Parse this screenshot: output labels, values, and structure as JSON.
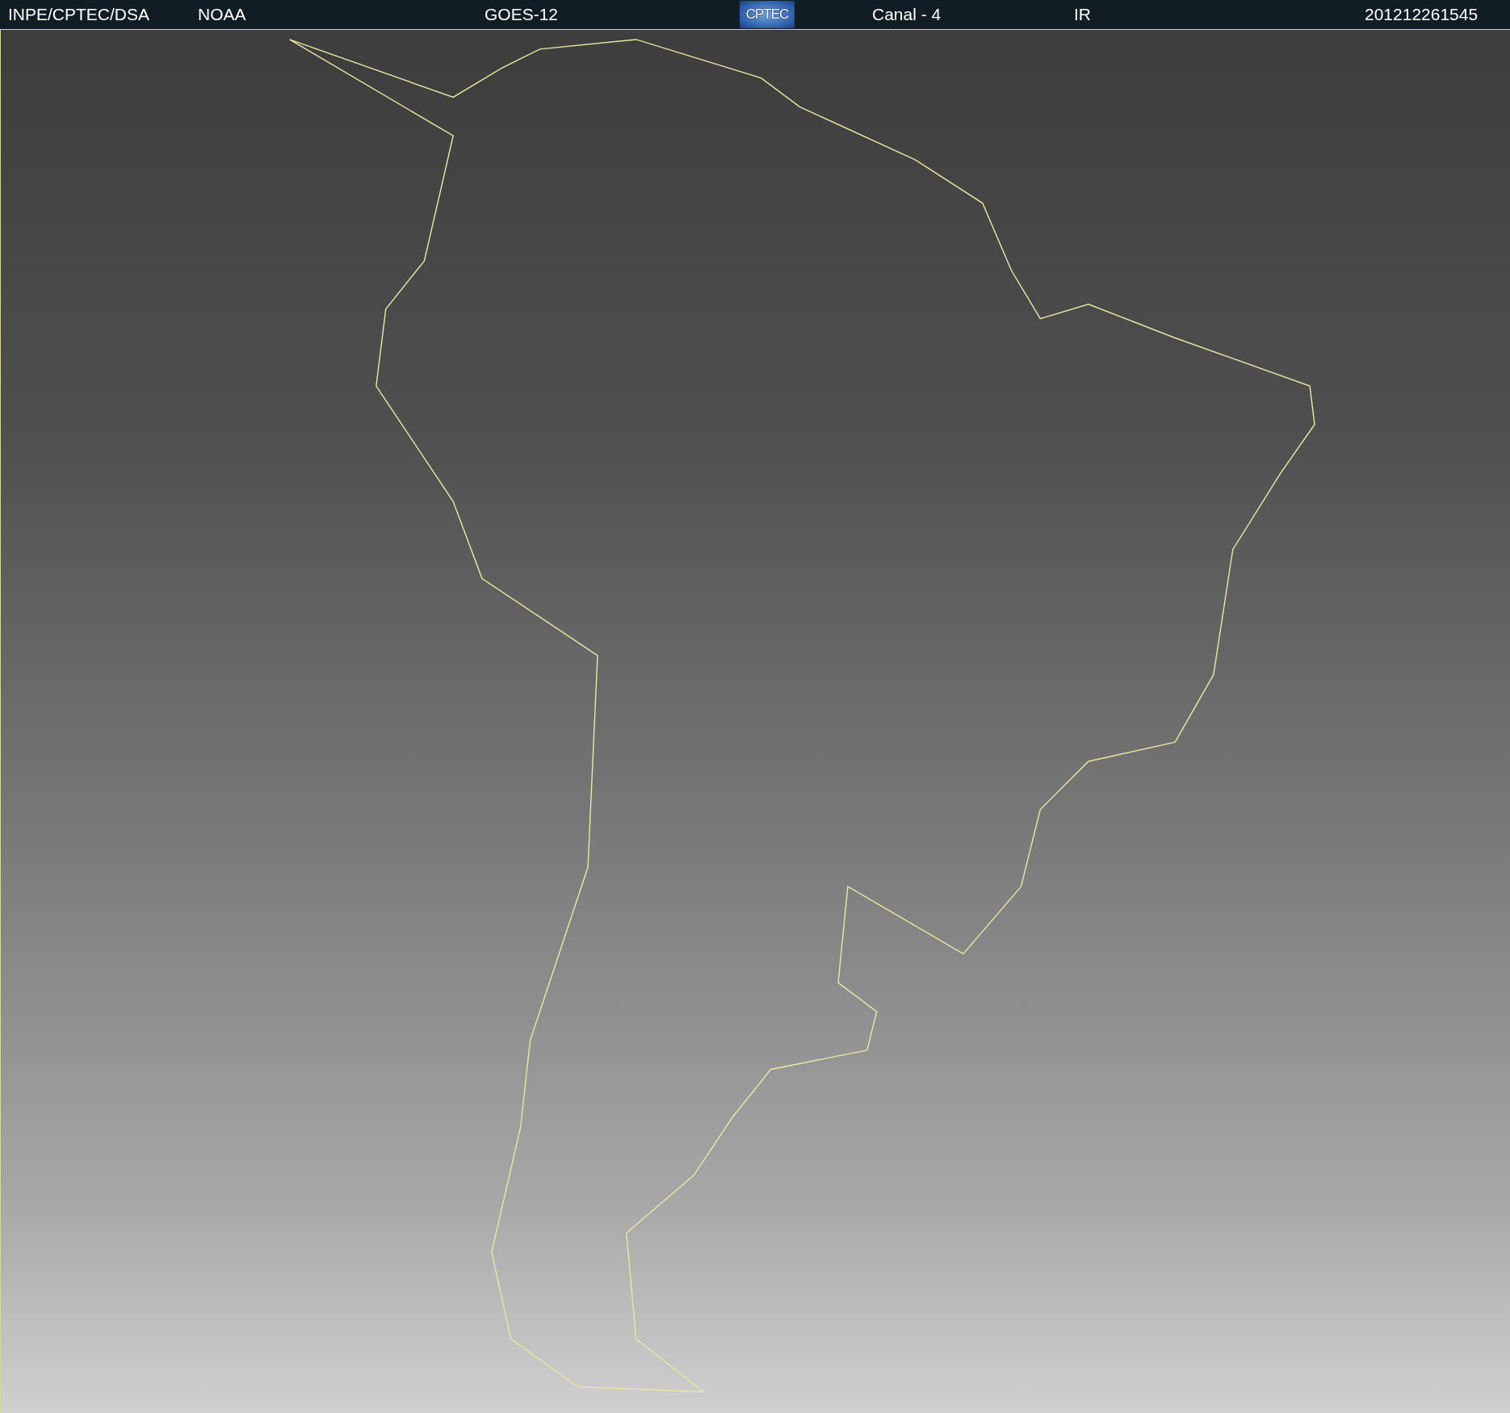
{
  "header": {
    "items": [
      {
        "kind": "text",
        "label": "INPE/CPTEC/DSA"
      },
      {
        "kind": "text",
        "label": "NOAA"
      },
      {
        "kind": "text",
        "label": "GOES-12"
      },
      {
        "kind": "logo",
        "label": "CPTEC"
      },
      {
        "kind": "text",
        "label": "Canal - 4"
      },
      {
        "kind": "text",
        "label": "IR"
      },
      {
        "kind": "text",
        "label": "201212261545"
      }
    ]
  }
}
